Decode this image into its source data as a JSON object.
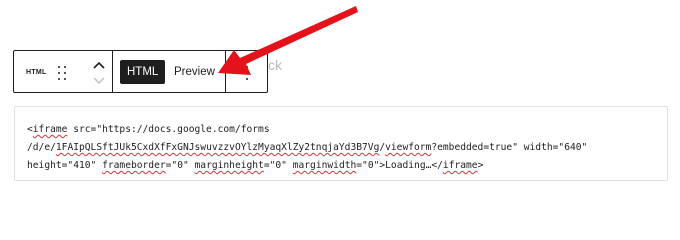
{
  "toolbar": {
    "block_type_icon_label": "HTML",
    "drag_icon": "drag-handle-icon",
    "move_up_icon": "chevron-up-icon",
    "move_down_icon": "chevron-down-icon",
    "mode_html_label": "HTML",
    "mode_preview_label": "Preview",
    "more_icon": "vertical-ellipsis-icon"
  },
  "hidden_text_fragment": "ck",
  "editor": {
    "line1_a": "<",
    "line1_b": "iframe",
    "line1_c": " src=\"https://docs.google.com/forms",
    "line2_a": "/d/e/",
    "line2_b": "1FAIpQLSftJUk5CxdXfFxGNJswuvzzvOYlzMyaqXlZy2tnqjaYd3B7Vg",
    "line2_c": "/",
    "line2_d": "viewform",
    "line2_e": "?embedded=true\" width=\"640\"",
    "line3_a": "height=\"410\" ",
    "line3_b": "frameborder",
    "line3_c": "=\"0\" ",
    "line3_d": "marginheight",
    "line3_e": "=\"0\" ",
    "line3_f": "marginwidth",
    "line3_g": "=\"0\">Loading…</",
    "line3_h": "iframe",
    "line3_i": ">"
  },
  "annotation": {
    "arrow_color": "#e3121b"
  }
}
